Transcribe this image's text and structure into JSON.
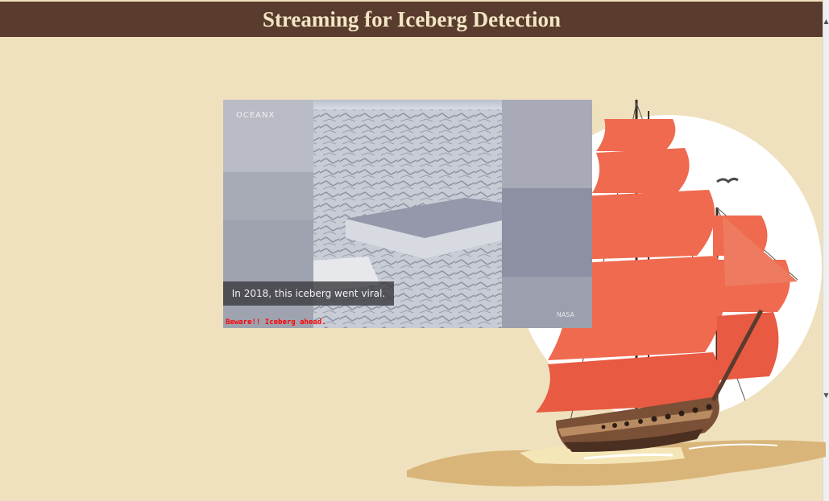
{
  "header": {
    "title": "Streaming for Iceberg Detection"
  },
  "stream": {
    "brand": "OCEANX",
    "caption": "In 2018, this iceberg went viral.",
    "credit": "NASA",
    "warning": "Beware!! Iceberg ahead."
  },
  "colors": {
    "header_bg": "#5a3c2e",
    "header_text": "#f3e6c4",
    "page_bg": "#efe1bd",
    "sail": "#ef6a4f",
    "warning": "#ff0000"
  }
}
